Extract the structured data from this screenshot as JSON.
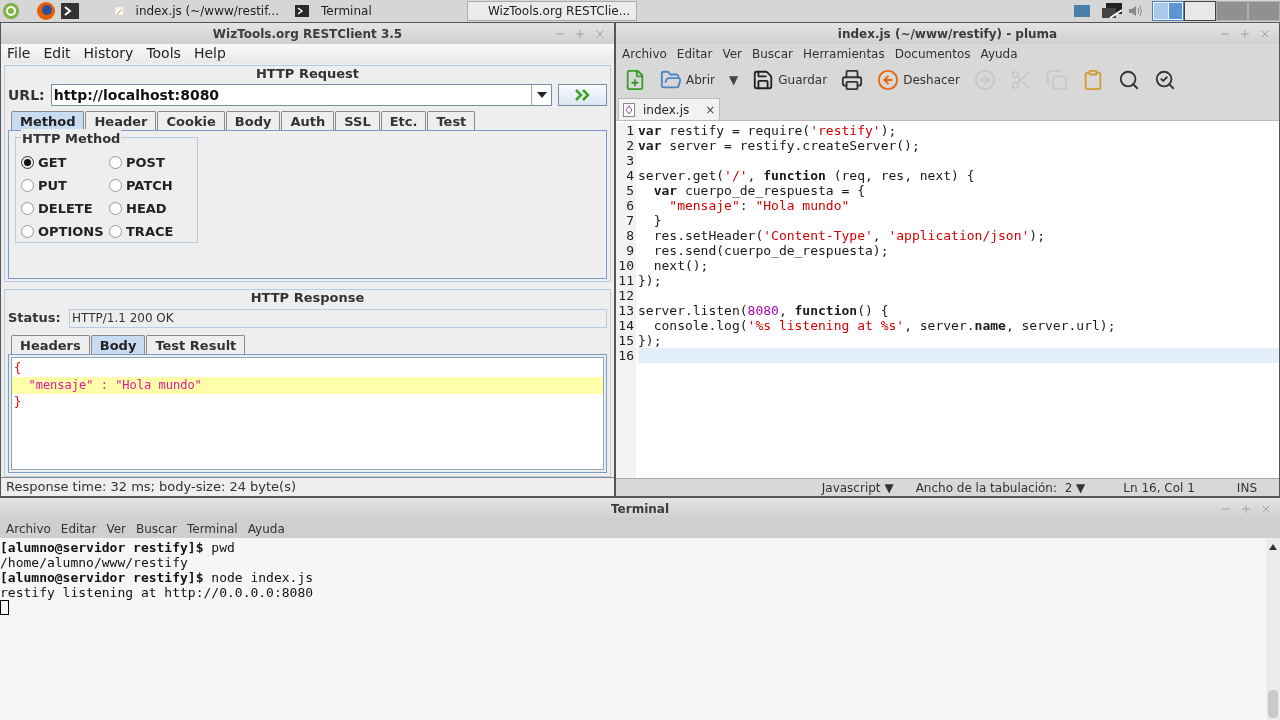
{
  "taskbar": {
    "tasks": [
      {
        "label": "index.js (~/www/restif...",
        "kind": "editor",
        "selected": false
      },
      {
        "label": "Terminal",
        "kind": "terminal",
        "selected": false
      },
      {
        "label": "WizTools.org RESTClie...",
        "kind": "restclient",
        "selected": true
      }
    ],
    "workspaces": [
      {
        "selected": true
      },
      {
        "selected": false
      },
      {
        "selected": false
      },
      {
        "selected": false
      }
    ]
  },
  "restclient": {
    "title": "WizTools.org RESTClient 3.5",
    "menu": [
      "File",
      "Edit",
      "History",
      "Tools",
      "Help"
    ],
    "request": {
      "section_title": "HTTP Request",
      "url_label": "URL:",
      "url": "http://localhost:8080",
      "tabs": [
        {
          "label": "Method",
          "selected": true
        },
        {
          "label": "Header",
          "selected": false
        },
        {
          "label": "Cookie",
          "selected": false
        },
        {
          "label": "Body",
          "selected": false
        },
        {
          "label": "Auth",
          "selected": false
        },
        {
          "label": "SSL",
          "selected": false
        },
        {
          "label": "Etc.",
          "selected": false
        },
        {
          "label": "Test",
          "selected": false
        }
      ],
      "method_group": "HTTP Method",
      "methods": [
        {
          "label": "GET",
          "selected": true
        },
        {
          "label": "POST",
          "selected": false
        },
        {
          "label": "PUT",
          "selected": false
        },
        {
          "label": "PATCH",
          "selected": false
        },
        {
          "label": "DELETE",
          "selected": false
        },
        {
          "label": "HEAD",
          "selected": false
        },
        {
          "label": "OPTIONS",
          "selected": false
        },
        {
          "label": "TRACE",
          "selected": false
        }
      ]
    },
    "response": {
      "section_title": "HTTP Response",
      "status_label": "Status:",
      "status": "HTTP/1.1 200 OK",
      "tabs": [
        {
          "label": "Headers",
          "selected": false
        },
        {
          "label": "Body",
          "selected": true
        },
        {
          "label": "Test Result",
          "selected": false
        }
      ],
      "body": [
        {
          "text": "{",
          "kind": "punct",
          "highlighted": false
        },
        {
          "text": "  \"mensaje\" : \"Hola mundo\"",
          "kind": "pair",
          "highlighted": true
        },
        {
          "text": "}",
          "kind": "punct",
          "highlighted": false
        }
      ]
    },
    "status_bar": "Response time: 32 ms; body-size: 24 byte(s)"
  },
  "editor": {
    "title": "index.js (~/www/restify) - pluma",
    "menu": [
      "Archivo",
      "Editar",
      "Ver",
      "Buscar",
      "Herramientas",
      "Documentos",
      "Ayuda"
    ],
    "toolbar": [
      {
        "kind": "new",
        "disabled": false
      },
      {
        "kind": "open",
        "label": "Abrir",
        "disabled": false
      },
      {
        "kind": "dropdown",
        "label": "▼",
        "disabled": false
      },
      {
        "kind": "save",
        "label": "Guardar",
        "disabled": false
      },
      {
        "kind": "print",
        "disabled": false
      },
      {
        "kind": "undo",
        "label": "Deshacer",
        "disabled": false
      },
      {
        "kind": "redo",
        "disabled": true
      },
      {
        "kind": "cut",
        "disabled": true
      },
      {
        "kind": "copy",
        "disabled": true
      },
      {
        "kind": "paste",
        "disabled": false
      },
      {
        "kind": "find",
        "disabled": false
      },
      {
        "kind": "replace",
        "disabled": false
      }
    ],
    "tab": {
      "label": "index.js",
      "close": "×"
    },
    "lines": [
      {
        "n": "1",
        "tokens": [
          {
            "kind": "keyword",
            "text": "var"
          },
          {
            "kind": "plain",
            "text": " restify = require("
          },
          {
            "kind": "string",
            "text": "'restify'"
          },
          {
            "kind": "plain",
            "text": ");"
          }
        ]
      },
      {
        "n": "2",
        "tokens": [
          {
            "kind": "keyword",
            "text": "var"
          },
          {
            "kind": "plain",
            "text": " server = restify.createServer();"
          }
        ]
      },
      {
        "n": "3"
      },
      {
        "n": "4",
        "tokens": [
          {
            "kind": "plain",
            "text": "server.get("
          },
          {
            "kind": "string",
            "text": "'/'"
          },
          {
            "kind": "plain",
            "text": ", "
          },
          {
            "kind": "keyword",
            "text": "function"
          },
          {
            "kind": "plain",
            "text": " (req, res, next) {"
          }
        ]
      },
      {
        "n": "5",
        "tokens": [
          {
            "kind": "keyword",
            "text": "  var"
          },
          {
            "kind": "plain",
            "text": " cuerpo_de_respuesta = {"
          }
        ]
      },
      {
        "n": "6",
        "tokens": [
          {
            "kind": "string",
            "text": "    \"mensaje\""
          },
          {
            "kind": "plain",
            "text": ": "
          },
          {
            "kind": "string",
            "text": "\"Hola mundo\""
          }
        ]
      },
      {
        "n": "7",
        "tokens": [
          {
            "kind": "plain",
            "text": "  }"
          }
        ]
      },
      {
        "n": "8",
        "tokens": [
          {
            "kind": "plain",
            "text": "  res.setHeader("
          },
          {
            "kind": "string",
            "text": "'Content-Type'"
          },
          {
            "kind": "plain",
            "text": ", "
          },
          {
            "kind": "string",
            "text": "'application/json'"
          },
          {
            "kind": "plain",
            "text": ");"
          }
        ]
      },
      {
        "n": "9",
        "tokens": [
          {
            "kind": "plain",
            "text": "  res.send(cuerpo_de_respuesta);"
          }
        ]
      },
      {
        "n": "10",
        "tokens": [
          {
            "kind": "plain",
            "text": "  next();"
          }
        ]
      },
      {
        "n": "11",
        "tokens": [
          {
            "kind": "plain",
            "text": "});"
          }
        ]
      },
      {
        "n": "12"
      },
      {
        "n": "13",
        "tokens": [
          {
            "kind": "plain",
            "text": "server.listen("
          },
          {
            "kind": "number",
            "text": "8080"
          },
          {
            "kind": "plain",
            "text": ", "
          },
          {
            "kind": "keyword",
            "text": "function"
          },
          {
            "kind": "plain",
            "text": "() {"
          }
        ]
      },
      {
        "n": "14",
        "tokens": [
          {
            "kind": "plain",
            "text": "  console.log("
          },
          {
            "kind": "string",
            "text": "'%s listening at %s'"
          },
          {
            "kind": "plain",
            "text": ", server."
          },
          {
            "kind": "keyword",
            "text": "name"
          },
          {
            "kind": "plain",
            "text": ", server.url);"
          }
        ]
      },
      {
        "n": "15",
        "tokens": [
          {
            "kind": "plain",
            "text": "});"
          }
        ]
      },
      {
        "n": "16",
        "current": true
      }
    ],
    "status_bar": [
      {
        "label": "Javascript",
        "dropdown": "▼"
      },
      {
        "label": "Ancho de la tabulación:  2",
        "dropdown": "▼"
      },
      {
        "label": "Ln 16, Col 1"
      },
      {
        "label": "INS"
      }
    ]
  },
  "terminal": {
    "title": "Terminal",
    "menu": [
      "Archivo",
      "Editar",
      "Ver",
      "Buscar",
      "Terminal",
      "Ayuda"
    ],
    "lines": [
      [
        {
          "kind": "prompt",
          "text": "[alumno@servidor restify]$"
        },
        {
          "kind": "plain",
          "text": " pwd"
        }
      ],
      [
        {
          "kind": "plain",
          "text": "/home/alumno/www/restify"
        }
      ],
      [
        {
          "kind": "prompt",
          "text": "[alumno@servidor restify]$"
        },
        {
          "kind": "plain",
          "text": " node index.js"
        }
      ],
      [
        {
          "kind": "plain",
          "text": "restify listening at http://0.0.0.0:8080"
        }
      ]
    ],
    "cursor": true
  }
}
